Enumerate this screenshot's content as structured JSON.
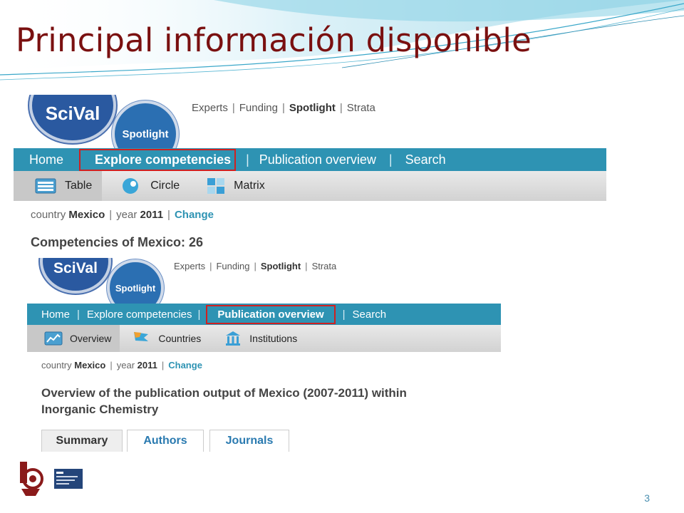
{
  "slide": {
    "title": "Principal información disponible",
    "page_number": "3"
  },
  "shot1": {
    "logo_scival": "SciVal",
    "logo_spotlight": "Spotlight",
    "top_links": [
      "Experts",
      "Funding",
      "Spotlight",
      "Strata"
    ],
    "nav": [
      "Home",
      "Explore competencies",
      "Publication overview",
      "Search"
    ],
    "subtabs": [
      "Table",
      "Circle",
      "Matrix"
    ],
    "crumb": {
      "country_label": "country",
      "country": "Mexico",
      "year_label": "year",
      "year": "2011",
      "change": "Change"
    },
    "heading": "Competencies of Mexico: 26"
  },
  "shot2": {
    "logo_scival": "SciVal",
    "logo_spotlight": "Spotlight",
    "top_links": [
      "Experts",
      "Funding",
      "Spotlight",
      "Strata"
    ],
    "nav": [
      "Home",
      "Explore competencies",
      "Publication overview",
      "Search"
    ],
    "subtabs": [
      "Overview",
      "Countries",
      "Institutions"
    ],
    "crumb": {
      "country_label": "country",
      "country": "Mexico",
      "year_label": "year",
      "year": "2011",
      "change": "Change"
    },
    "heading_line1": "Overview of the publication output of Mexico (2007-2011) within",
    "heading_line2": "Inorganic Chemistry",
    "tabs": [
      "Summary",
      "Authors",
      "Journals"
    ]
  },
  "colors": {
    "title": "#7a1010",
    "nav": "#2e93b3",
    "highlight": "#d02020"
  }
}
